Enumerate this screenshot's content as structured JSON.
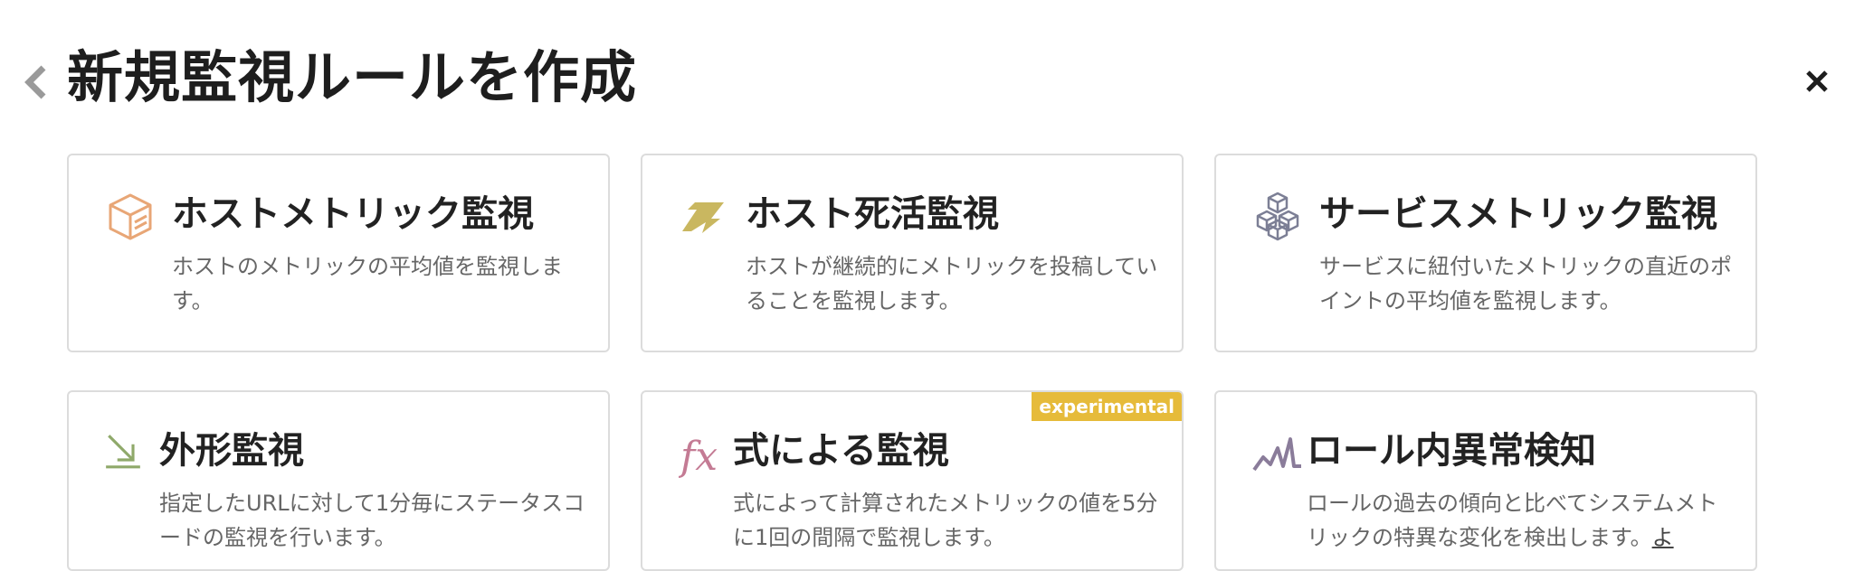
{
  "header": {
    "title": "新規監視ルールを作成",
    "back_icon": "chevron-left-icon",
    "close_icon": "close-icon"
  },
  "cards": [
    {
      "title": "ホストメトリック監視",
      "description": "ホストのメトリックの平均値を監視します。",
      "icon": "cube-icon",
      "color": "#e8a676"
    },
    {
      "title": "ホスト死活監視",
      "description": "ホストが継続的にメトリックを投稿していることを監視します。",
      "icon": "heartbeat-zigzag-icon",
      "color": "#c9b760"
    },
    {
      "title": "サービスメトリック監視",
      "description": "サービスに紐付いたメトリックの直近のポイントの平均値を監視します。",
      "icon": "stacked-cubes-icon",
      "color": "#7c7f95"
    },
    {
      "title": "外形監視",
      "description": "指定したURLに対して1分毎にステータスコードの監視を行います。",
      "icon": "arrow-down-right-icon",
      "color": "#8fa96a"
    },
    {
      "title": "式による監視",
      "description": "式によって計算されたメトリックの値を5分に1回の間隔で監視します。",
      "icon": "fx-icon",
      "color": "#c47b94",
      "badge": "experimental"
    },
    {
      "title": "ロール内異常検知",
      "description": "ロールの過去の傾向と比べてシステムメトリックの特異な変化を検出します。",
      "link": "よ",
      "icon": "anomaly-wave-icon",
      "color": "#8a7c9a"
    }
  ]
}
